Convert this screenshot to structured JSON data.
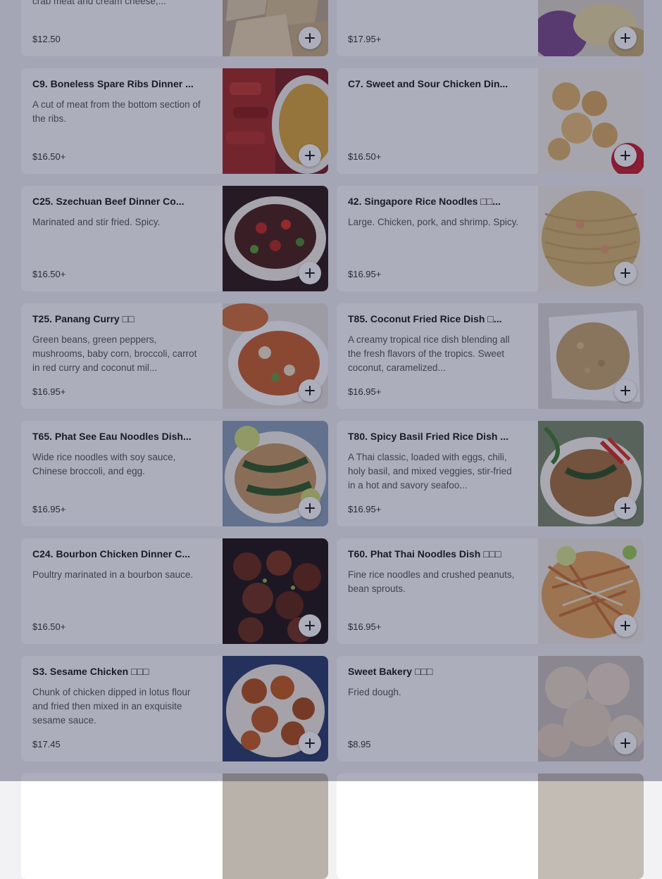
{
  "menu": {
    "items": [
      {
        "title": "",
        "description": "of creamy, savory filling made with real crab meat and cream cheese,...",
        "price": "$12.50",
        "photo_alt": "crab rangoon photo"
      },
      {
        "title": "",
        "description": "",
        "price": "$17.95+",
        "photo_alt": "dish photo"
      },
      {
        "title": "C9. Boneless Spare Ribs Dinner ...",
        "description": "A cut of meat from the bottom section of the ribs.",
        "price": "$16.50+",
        "photo_alt": "boneless spare ribs photo"
      },
      {
        "title": "C7. Sweet and Sour Chicken Din...",
        "description": "",
        "price": "$16.50+",
        "photo_alt": "sweet and sour chicken photo"
      },
      {
        "title": "C25. Szechuan Beef Dinner Co...",
        "description": "Marinated and stir fried. Spicy.",
        "price": "$16.50+",
        "photo_alt": "szechuan beef photo"
      },
      {
        "title": "42. Singapore Rice Noodles □□...",
        "description": "Large. Chicken, pork, and shrimp. Spicy.",
        "price": "$16.95+",
        "photo_alt": "singapore rice noodles photo"
      },
      {
        "title": "T25. Panang Curry □□",
        "description": "Green beans, green peppers, mushrooms, baby corn, broccoli, carrot in red curry and coconut mil...",
        "price": "$16.95+",
        "photo_alt": "panang curry photo"
      },
      {
        "title": "T85. Coconut Fried Rice Dish □...",
        "description": "A creamy tropical rice dish blending all the fresh flavors of the tropics. Sweet coconut, caramelized...",
        "price": "$16.95+",
        "photo_alt": "coconut fried rice photo"
      },
      {
        "title": "T65. Phat See Eau Noodles Dish...",
        "description": "Wide rice noodles with soy sauce, Chinese broccoli, and egg.",
        "price": "$16.95+",
        "photo_alt": "phat see eau noodles photo"
      },
      {
        "title": "T80. Spicy Basil Fried Rice Dish ...",
        "description": "A Thai classic, loaded with eggs, chili, holy basil, and mixed veggies, stir-fried in a hot and savory seafoo...",
        "price": "$16.95+",
        "photo_alt": "spicy basil fried rice photo"
      },
      {
        "title": "C24. Bourbon Chicken Dinner C...",
        "description": "Poultry marinated in a bourbon sauce.",
        "price": "$16.50+",
        "photo_alt": "bourbon chicken photo"
      },
      {
        "title": "T60. Phat Thai Noodles Dish □□□",
        "description": "Fine rice noodles and crushed peanuts, bean sprouts.",
        "price": "$16.95+",
        "photo_alt": "phat thai noodles photo"
      },
      {
        "title": "S3. Sesame Chicken □□□",
        "description": "Chunk of chicken dipped in lotus flour and fried then mixed in an exquisite sesame sauce.",
        "price": "$17.45",
        "photo_alt": "sesame chicken photo"
      },
      {
        "title": "Sweet Bakery □□□",
        "description": "Fried dough.",
        "price": "$8.95",
        "photo_alt": "sweet bakery photo"
      },
      {
        "title": "",
        "description": "",
        "price": "",
        "photo_alt": "dish photo"
      },
      {
        "title": "",
        "description": "",
        "price": "",
        "photo_alt": "dish photo"
      }
    ]
  },
  "colors": {
    "overlay": "#1c1e44",
    "card_background": "#ffffff",
    "page_background": "#f2f2f4"
  },
  "icons": {
    "add_button": "plus-icon"
  }
}
